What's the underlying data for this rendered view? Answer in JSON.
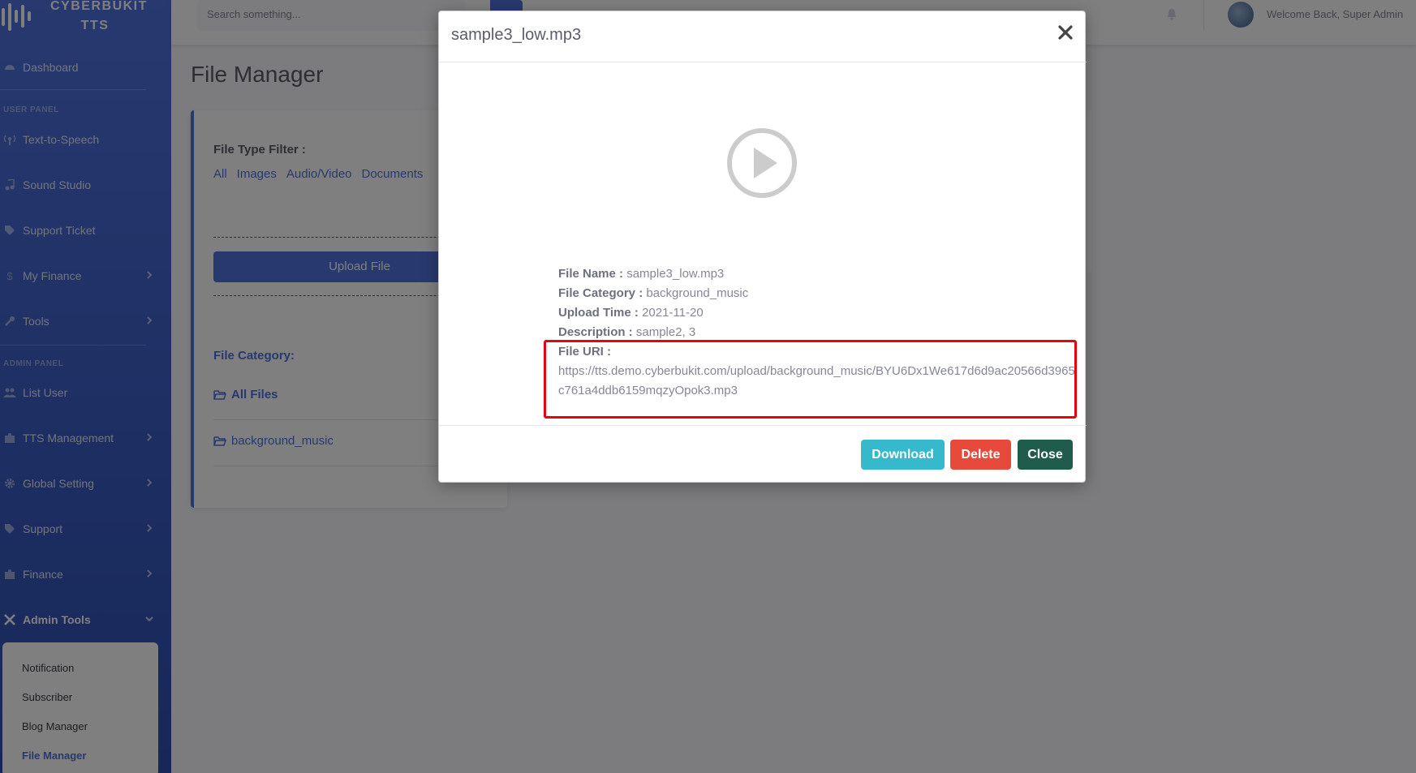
{
  "brand": {
    "name": "CYBERBUKIT TTS"
  },
  "sidebar": {
    "dashboard": "Dashboard",
    "user_panel_heading": "USER PANEL",
    "text_to_speech": "Text-to-Speech",
    "sound_studio": "Sound Studio",
    "support_ticket": "Support Ticket",
    "my_finance": "My Finance",
    "tools": "Tools",
    "admin_panel_heading": "ADMIN PANEL",
    "list_user": "List User",
    "tts_management": "TTS Management",
    "global_setting": "Global Setting",
    "support": "Support",
    "finance": "Finance",
    "admin_tools": "Admin Tools",
    "admin_tools_items": [
      "Notification",
      "Subscriber",
      "Blog Manager",
      "File Manager"
    ]
  },
  "topbar": {
    "search_placeholder": "Search something...",
    "welcome": "Welcome Back, Super Admin"
  },
  "main": {
    "page_title": "File Manager",
    "filter_label": "File Type Filter :",
    "filters": [
      "All",
      "Images",
      "Audio/Video",
      "Documents"
    ],
    "upload_button": "Upload File",
    "category_label": "File Category:",
    "folders": [
      "All Files",
      "background_music"
    ]
  },
  "modal": {
    "title": "sample3_low.mp3",
    "file_name_label": "File Name :",
    "file_name": "sample3_low.mp3",
    "file_category_label": "File Category :",
    "file_category": "background_music",
    "upload_time_label": "Upload Time :",
    "upload_time": "2021-11-20",
    "description_label": "Description :",
    "description": "sample2, 3",
    "file_uri_label": "File URI :",
    "file_uri": "https://tts.demo.cyberbukit.com/upload/background_music/BYU6Dx1We617d6d9ac20566d3965c761a4ddb6159mqzyOpok3.mp3",
    "download_button": "Download",
    "delete_button": "Delete",
    "close_button": "Close"
  },
  "colors": {
    "primary": "#4e73df",
    "info": "#36b9cc",
    "danger": "#e74a3b",
    "dark_green": "#1f5c4b",
    "highlight": "#e3070f"
  }
}
